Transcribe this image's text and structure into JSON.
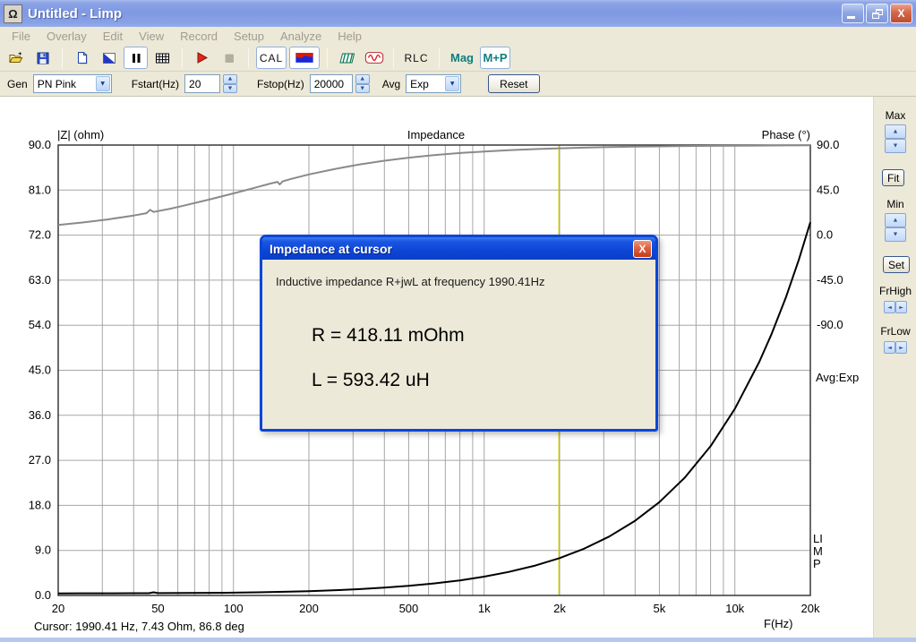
{
  "window": {
    "title": "Untitled - Limp",
    "icon": "omega"
  },
  "menu": {
    "items": [
      "File",
      "Overlay",
      "Edit",
      "View",
      "Record",
      "Setup",
      "Analyze",
      "Help"
    ]
  },
  "toolbar": {
    "cal_label": "CAL",
    "rlc_label": "RLC",
    "mag_label": "Mag",
    "mp_label": "M+P"
  },
  "params": {
    "gen_label": "Gen",
    "gen_value": "PN Pink",
    "fstart_label": "Fstart(Hz)",
    "fstart_value": "20",
    "fstop_label": "Fstop(Hz)",
    "fstop_value": "20000",
    "avg_label": "Avg",
    "avg_value": "Exp",
    "reset_label": "Reset"
  },
  "side_panel": {
    "max_label": "Max",
    "fit_label": "Fit",
    "min_label": "Min",
    "set_label": "Set",
    "frhigh_label": "FrHigh",
    "frlow_label": "FrLow"
  },
  "overlays": {
    "avg_status": "Avg:Exp",
    "limp_vertical": "LIMP"
  },
  "dialog": {
    "title": "Impedance at cursor",
    "message": "Inductive impedance R+jwL at frequency 1990.41Hz",
    "r_line": "R = 418.11 mOhm",
    "l_line": "L = 593.42 uH"
  },
  "statusbar": {
    "cursor_text": "Cursor: 1990.41 Hz, 7.43 Ohm, 86.8 deg"
  },
  "colors": {
    "titlebar_inactive": "#8AA2E4",
    "dialog_titlebar": "#0C46D6",
    "window_chrome": "#ECE9D8",
    "toolbar_accent_teal": "#0E7E7E"
  },
  "chart_data": {
    "type": "line",
    "title": "Impedance",
    "grid_color": "#A6A6A6",
    "border_color": "#2A2A2A",
    "left_axis": {
      "label": "|Z| (ohm)",
      "min": 0,
      "max": 90,
      "tick_values": [
        90,
        81,
        72,
        63,
        54,
        45,
        36,
        27,
        18,
        9,
        0
      ],
      "tick_labels": [
        "90.0",
        "81.0",
        "72.0",
        "63.0",
        "54.0",
        "45.0",
        "36.0",
        "27.0",
        "18.0",
        "9.0",
        "0.0"
      ],
      "grid_values": [
        81,
        72,
        63,
        54,
        45,
        36,
        27,
        18,
        9
      ]
    },
    "right_axis": {
      "label": "Phase (°)",
      "max": 90,
      "min": -90,
      "deg_per_division": 45,
      "tick_values": [
        90,
        45,
        0,
        -45,
        -90
      ],
      "tick_labels": [
        "90.0",
        "45.0",
        "0.0",
        "-45.0",
        "-90.0"
      ]
    },
    "x_axis": {
      "label": "F(Hz)",
      "scale": "log",
      "min": 20,
      "max": 20000,
      "tick_values": [
        20,
        50,
        100,
        200,
        500,
        1000,
        2000,
        5000,
        10000,
        20000
      ],
      "tick_labels": [
        "20",
        "50",
        "100",
        "200",
        "500",
        "1k",
        "2k",
        "5k",
        "10k",
        "20k"
      ],
      "grid_values": [
        30,
        40,
        50,
        60,
        70,
        80,
        90,
        100,
        200,
        300,
        400,
        500,
        600,
        700,
        800,
        900,
        1000,
        2000,
        3000,
        4000,
        5000,
        6000,
        7000,
        8000,
        9000,
        10000
      ]
    },
    "cursor": {
      "frequency_hz": 1990.41,
      "impedance_ohm": 7.43,
      "phase_deg": 86.8,
      "color": "#C2C200"
    },
    "series": [
      {
        "id": "impedance-magnitude",
        "name": "|Z| magnitude",
        "axis": "left",
        "color": "#000000",
        "points": [
          [
            20,
            0.42
          ],
          [
            25,
            0.43
          ],
          [
            31.5,
            0.43
          ],
          [
            40,
            0.44
          ],
          [
            46,
            0.45
          ],
          [
            48,
            0.62
          ],
          [
            50,
            0.46
          ],
          [
            63,
            0.48
          ],
          [
            80,
            0.51
          ],
          [
            100,
            0.56
          ],
          [
            125,
            0.63
          ],
          [
            160,
            0.73
          ],
          [
            200,
            0.85
          ],
          [
            250,
            1.02
          ],
          [
            315,
            1.25
          ],
          [
            400,
            1.55
          ],
          [
            500,
            1.91
          ],
          [
            630,
            2.39
          ],
          [
            800,
            3.01
          ],
          [
            1000,
            3.75
          ],
          [
            1250,
            4.68
          ],
          [
            1600,
            5.98
          ],
          [
            2000,
            7.47
          ],
          [
            2500,
            9.33
          ],
          [
            3150,
            11.75
          ],
          [
            4000,
            14.92
          ],
          [
            5000,
            18.65
          ],
          [
            6300,
            23.5
          ],
          [
            8000,
            29.83
          ],
          [
            10000,
            37.29
          ],
          [
            12500,
            46.61
          ],
          [
            14000,
            52.2
          ],
          [
            16000,
            59.66
          ],
          [
            18000,
            67.11
          ],
          [
            20000,
            74.58
          ]
        ]
      },
      {
        "id": "phase",
        "name": "Phase",
        "axis": "right",
        "color": "#8A8A8A",
        "points": [
          [
            20,
            10.1
          ],
          [
            25,
            12.6
          ],
          [
            31.5,
            15.7
          ],
          [
            40,
            19.6
          ],
          [
            45,
            21.9
          ],
          [
            46.5,
            25.3
          ],
          [
            48,
            23.2
          ],
          [
            56,
            26.4
          ],
          [
            63,
            29.3
          ],
          [
            80,
            35.5
          ],
          [
            100,
            41.7
          ],
          [
            112,
            44.9
          ],
          [
            125,
            48.1
          ],
          [
            140,
            51.4
          ],
          [
            150,
            53.2
          ],
          [
            153,
            50.6
          ],
          [
            157,
            53.7
          ],
          [
            170,
            56.2
          ],
          [
            200,
            60.7
          ],
          [
            250,
            65.8
          ],
          [
            315,
            70.4
          ],
          [
            400,
            74.3
          ],
          [
            500,
            77.4
          ],
          [
            630,
            79.9
          ],
          [
            800,
            82.0
          ],
          [
            1000,
            83.6
          ],
          [
            1250,
            84.9
          ],
          [
            1600,
            86.0
          ],
          [
            2000,
            86.8
          ],
          [
            2500,
            87.4
          ],
          [
            3150,
            88.0
          ],
          [
            4000,
            88.4
          ],
          [
            5000,
            88.7
          ],
          [
            6300,
            89.0
          ],
          [
            8000,
            89.2
          ],
          [
            10000,
            89.4
          ],
          [
            12500,
            89.5
          ],
          [
            16000,
            89.6
          ],
          [
            20000,
            89.7
          ]
        ]
      }
    ]
  }
}
